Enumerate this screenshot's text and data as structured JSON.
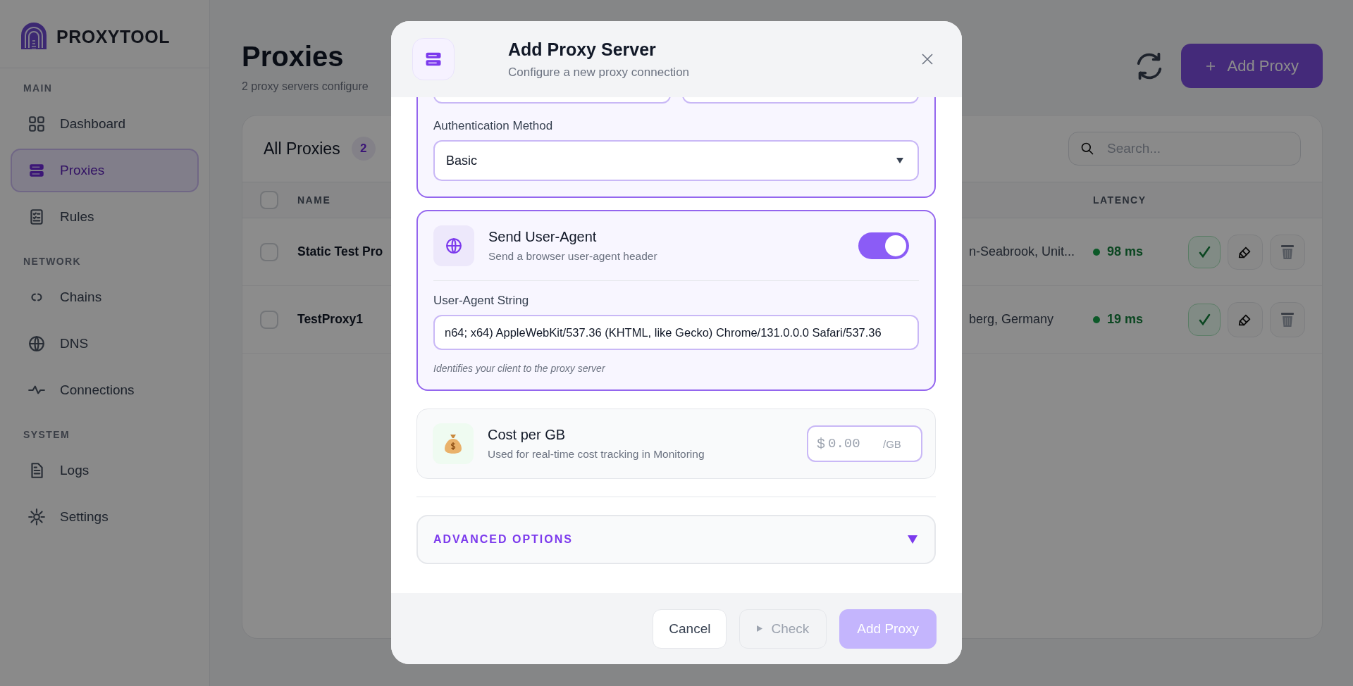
{
  "app": {
    "logo_text": "PROXYTOOL"
  },
  "sidebar": {
    "sections": [
      {
        "label": "MAIN",
        "items": [
          {
            "label": "Dashboard",
            "selected": false
          },
          {
            "label": "Proxies",
            "selected": true
          },
          {
            "label": "Rules",
            "selected": false
          }
        ]
      },
      {
        "label": "NETWORK",
        "items": [
          {
            "label": "Chains",
            "selected": false
          },
          {
            "label": "DNS",
            "selected": false
          },
          {
            "label": "Connections",
            "selected": false
          }
        ]
      },
      {
        "label": "SYSTEM",
        "items": [
          {
            "label": "Logs",
            "selected": false
          },
          {
            "label": "Settings",
            "selected": false
          }
        ]
      }
    ]
  },
  "page": {
    "title": "Proxies",
    "subtitle": "2 proxy servers configure",
    "add_button": "Add Proxy"
  },
  "proxies_card": {
    "title": "All Proxies",
    "count": "2",
    "search": {
      "placeholder": "Search..."
    }
  },
  "table": {
    "all_selected": false,
    "columns": [
      {
        "label": "NAME"
      },
      {
        "label": "LATENCY"
      }
    ],
    "rows": [
      {
        "name": "Static Test Pro",
        "location": "n-Seabrook, Unit...",
        "latency": "98 ms",
        "selected": false
      },
      {
        "name": "TestProxy1",
        "location": "berg, Germany",
        "latency": "19 ms",
        "selected": false
      }
    ]
  },
  "modal": {
    "title": "Add Proxy Server",
    "subtitle": "Configure a new proxy connection",
    "auth_card": {
      "top_fields": [
        {
          "kind": "input"
        },
        {
          "kind": "input"
        }
      ],
      "label": "Authentication Method",
      "value": "Basic"
    },
    "user_agent": {
      "title": "Send User-Agent",
      "description": "Send a browser user-agent header",
      "on": true,
      "field_label": "User-Agent String",
      "value": "n64; x64) AppleWebKit/537.36 (KHTML, like Gecko) Chrome/131.0.0.0 Safari/537.36",
      "help": "Identifies your client to the proxy server"
    },
    "cost": {
      "title": "Cost per GB",
      "description": "Used for real-time cost tracking in Monitoring",
      "prefix": "$",
      "placeholder": "0.00",
      "suffix": "/GB"
    },
    "advanced": {
      "label": "ADVANCED OPTIONS",
      "expanded": false
    },
    "buttons": [
      {
        "label": "Cancel",
        "kind": "secondary",
        "disabled": false
      },
      {
        "label": "Check",
        "kind": "check",
        "disabled": true
      },
      {
        "label": "Add Proxy",
        "kind": "primary",
        "disabled": true
      }
    ]
  }
}
